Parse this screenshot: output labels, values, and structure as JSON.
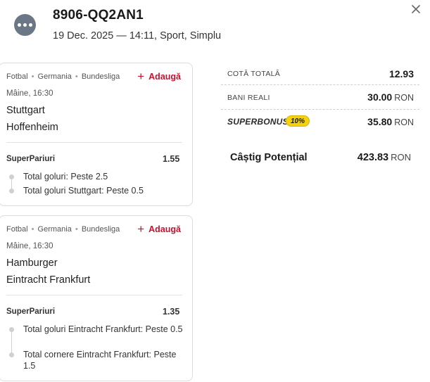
{
  "ticket": {
    "id": "8906-QQ2AN1",
    "meta": "19 Dec. 2025 — 14:11, Sport, Simplu"
  },
  "icons": {
    "more": "more-horizontal-icon",
    "close": "close-icon",
    "add": "plus-icon",
    "selection": "bullet-dot-icon"
  },
  "colors": {
    "accent_red": "#c8102e",
    "bonus_yellow": "#f5d20c",
    "more_button": "#6b7686"
  },
  "events": [
    {
      "sport": "Fotbal",
      "country": "Germania",
      "league": "Bundesliga",
      "add_label": "Adaugă",
      "time": "Mâine, 16:30",
      "home": "Stuttgart",
      "away": "Hoffenheim",
      "bet_type": "SuperPariuri",
      "odds": "1.55",
      "selections": [
        "Total goluri: Peste 2.5",
        "Total goluri Stuttgart: Peste 0.5"
      ]
    },
    {
      "sport": "Fotbal",
      "country": "Germania",
      "league": "Bundesliga",
      "add_label": "Adaugă",
      "time": "Mâine, 16:30",
      "home": "Hamburger",
      "away": "Eintracht Frankfurt",
      "bet_type": "SuperPariuri",
      "odds": "1.35",
      "selections": [
        "Total goluri Eintracht Frankfurt: Peste 0.5",
        "Total cornere Eintracht Frankfurt: Peste 1.5"
      ]
    }
  ],
  "summary": {
    "total_odds_label": "COTĂ TOTALĂ",
    "total_odds": "12.93",
    "real_money_label": "BANI REALI",
    "real_money": "30.00",
    "currency": "RON",
    "superbonus_label": "SUPERBONUS",
    "superbonus_percent": "10%",
    "superbonus_value": "35.80",
    "potential_label": "Câștig Potențial",
    "potential_value": "423.83"
  }
}
